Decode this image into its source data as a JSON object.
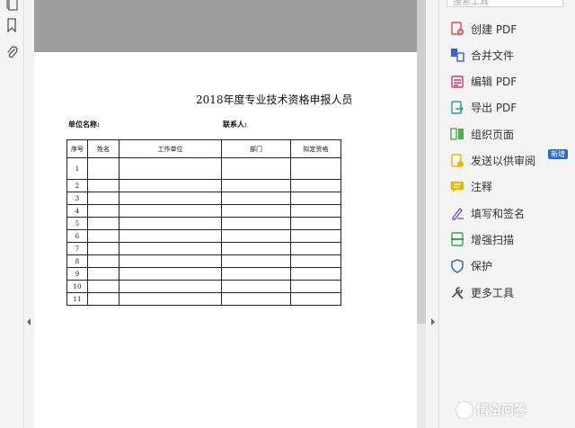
{
  "search": {
    "placeholder": "搜索工具"
  },
  "document": {
    "title": "2018年度专业技术资格申报人员",
    "unit_label": "单位名称:",
    "contact_label": "联系人:",
    "table": {
      "headers": [
        "序号",
        "姓名",
        "工作单位",
        "部门",
        "拟定资格"
      ],
      "rows": [
        "1",
        "2",
        "3",
        "4",
        "5",
        "6",
        "7",
        "8",
        "9",
        "10",
        "11"
      ]
    }
  },
  "tools": [
    {
      "label": "创建 PDF",
      "icon": "create-pdf-icon",
      "color": "#e34850"
    },
    {
      "label": "合并文件",
      "icon": "combine-files-icon",
      "color": "#3b63c4"
    },
    {
      "label": "编辑 PDF",
      "icon": "edit-pdf-icon",
      "color": "#d4357a"
    },
    {
      "label": "导出 PDF",
      "icon": "export-pdf-icon",
      "color": "#2a9d8f"
    },
    {
      "label": "组织页面",
      "icon": "organize-pages-icon",
      "color": "#4caf50"
    },
    {
      "label": "发送以供审阅",
      "icon": "send-review-icon",
      "color": "#e8b800"
    },
    {
      "label": "注释",
      "icon": "comment-icon",
      "color": "#e8b800"
    },
    {
      "label": "填写和签名",
      "icon": "fill-sign-icon",
      "color": "#7b55c7"
    },
    {
      "label": "增强扫描",
      "icon": "enhance-scan-icon",
      "color": "#3aa35b"
    },
    {
      "label": "保护",
      "icon": "protect-icon",
      "color": "#2d6bc4"
    },
    {
      "label": "更多工具",
      "icon": "more-tools-icon",
      "color": "#555555"
    }
  ],
  "badge": {
    "text": "新增"
  },
  "watermark": {
    "text": "悟空问答"
  },
  "colors": {
    "accent": "#2d6bc4",
    "viewer_gray": "#9e9e9e"
  }
}
